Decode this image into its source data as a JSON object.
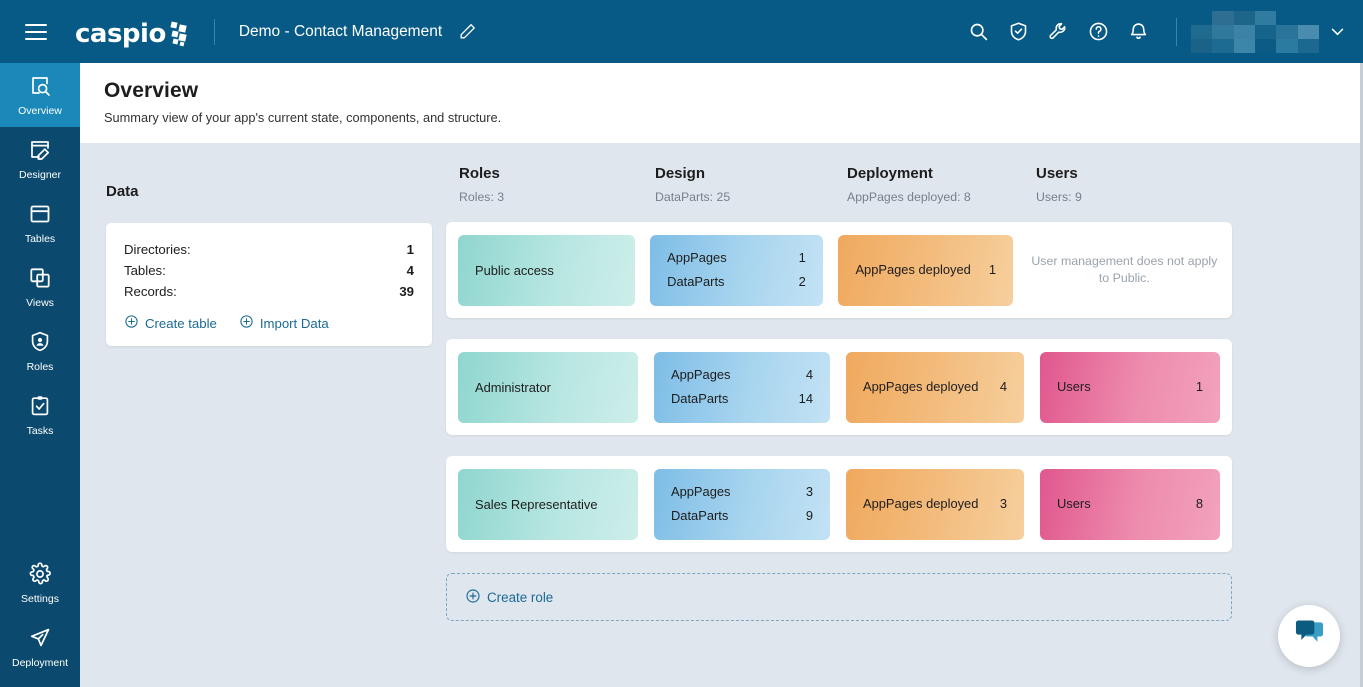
{
  "topbar": {
    "menu_icon": "hamburger-icon",
    "logo_text": "caspio",
    "app_title": "Demo - Contact Management",
    "edit_icon": "pencil-icon",
    "icons": [
      "search-icon",
      "shield-check-icon",
      "wrench-icon",
      "help-circle-icon",
      "bell-icon"
    ],
    "user_name": "",
    "chevron_icon": "chevron-down-icon",
    "bg_color": "#075a85"
  },
  "sidebar": {
    "items": [
      {
        "label": "Overview",
        "icon": "overview-search-icon",
        "active": true
      },
      {
        "label": "Designer",
        "icon": "designer-pencil-icon",
        "active": false
      },
      {
        "label": "Tables",
        "icon": "table-icon",
        "active": false
      },
      {
        "label": "Views",
        "icon": "views-stack-icon",
        "active": false
      },
      {
        "label": "Roles",
        "icon": "roles-shield-icon",
        "active": false
      },
      {
        "label": "Tasks",
        "icon": "tasks-clipboard-icon",
        "active": false
      }
    ],
    "bottom_items": [
      {
        "label": "Settings",
        "icon": "gear-icon"
      },
      {
        "label": "Deployment",
        "icon": "paper-plane-icon"
      }
    ],
    "active_color": "#1a88b8",
    "bg_color": "#0b4a6e"
  },
  "page": {
    "title": "Overview",
    "subtitle": "Summary view of your app's current state, components, and structure."
  },
  "data_section": {
    "title": "Data",
    "rows": [
      {
        "label": "Directories:",
        "value": "1"
      },
      {
        "label": "Tables:",
        "value": "4"
      },
      {
        "label": "Records:",
        "value": "39"
      }
    ],
    "links": [
      {
        "label": "Create table",
        "icon": "plus-circle-icon"
      },
      {
        "label": "Import Data",
        "icon": "plus-circle-icon"
      }
    ]
  },
  "columns": [
    {
      "title": "Roles",
      "summary": "Roles: 3"
    },
    {
      "title": "Design",
      "summary": "DataParts: 25"
    },
    {
      "title": "Deployment",
      "summary": "AppPages deployed: 8"
    },
    {
      "title": "Users",
      "summary": "Users: 9"
    }
  ],
  "roles": [
    {
      "name": "Public access",
      "design": [
        {
          "label": "AppPages",
          "value": "1"
        },
        {
          "label": "DataParts",
          "value": "2"
        }
      ],
      "deployment": {
        "label": "AppPages deployed",
        "value": "1"
      },
      "users": null,
      "users_note": "User management does not apply to Public."
    },
    {
      "name": "Administrator",
      "design": [
        {
          "label": "AppPages",
          "value": "4"
        },
        {
          "label": "DataParts",
          "value": "14"
        }
      ],
      "deployment": {
        "label": "AppPages deployed",
        "value": "4"
      },
      "users": {
        "label": "Users",
        "value": "1"
      },
      "users_note": null
    },
    {
      "name": "Sales Representative",
      "design": [
        {
          "label": "AppPages",
          "value": "3"
        },
        {
          "label": "DataParts",
          "value": "9"
        }
      ],
      "deployment": {
        "label": "AppPages deployed",
        "value": "3"
      },
      "users": {
        "label": "Users",
        "value": "8"
      },
      "users_note": null
    }
  ],
  "create_role": {
    "label": "Create role",
    "icon": "plus-circle-icon"
  },
  "chat": {
    "icon": "chat-bubbles-icon"
  },
  "colors": {
    "tile_role": "#8fd6cf",
    "tile_design": "#7ebde6",
    "tile_deploy": "#f0a95e",
    "tile_users": "#e0578e",
    "link": "#1b6a96",
    "content_bg": "#dfe6ee"
  }
}
